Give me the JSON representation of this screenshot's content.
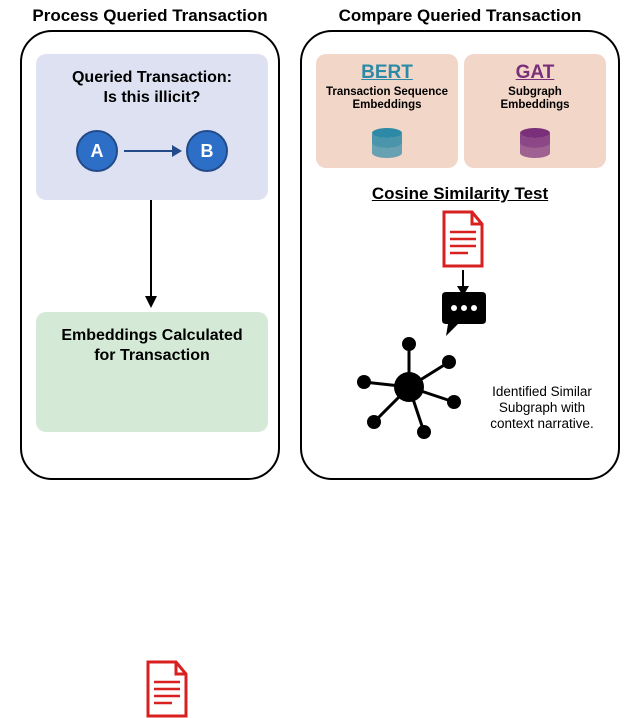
{
  "left": {
    "title": "Process Queried Transaction",
    "query": {
      "line1": "Queried Transaction:",
      "line2": "Is this illicit?",
      "nodeA": "A",
      "nodeB": "B"
    },
    "embeddings": {
      "line1": "Embeddings Calculated",
      "line2": "for Transaction"
    }
  },
  "right": {
    "title": "Compare Queried Transaction",
    "bert": {
      "name": "BERT",
      "sub1": "Transaction Sequence",
      "sub2": "Embeddings"
    },
    "gat": {
      "name": "GAT",
      "sub1": "Subgraph",
      "sub2": "Embeddings"
    },
    "cosine": "Cosine Similarity Test",
    "narrative": {
      "l1": "Identified Similar",
      "l2": "Subgraph with",
      "l3": "context narrative."
    }
  }
}
